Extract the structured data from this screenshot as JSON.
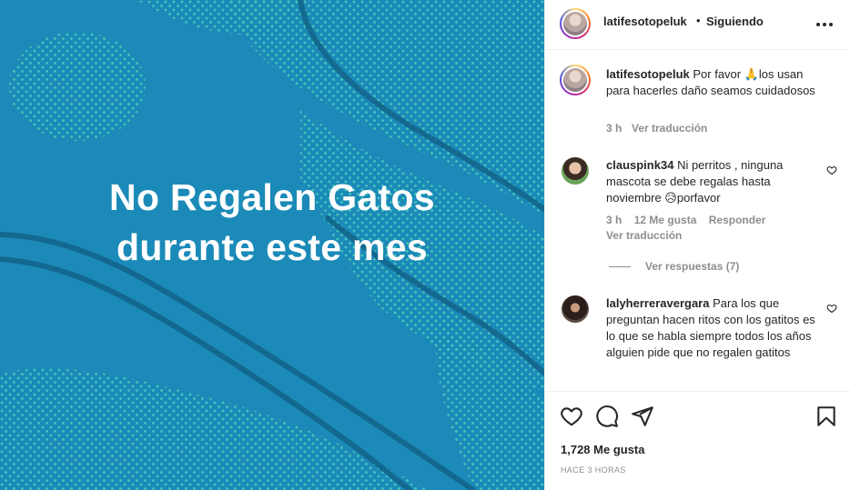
{
  "post_image": {
    "headline_line1": "No Regalen Gatos",
    "headline_line2": "durante este mes",
    "background_color": "#1b8ab8",
    "dot_color": "#4fd1b8"
  },
  "header": {
    "username": "latifesotopeluk",
    "separator": "•",
    "follow_status": "Siguiendo",
    "more_icon": "more-horizontal-icon"
  },
  "caption": {
    "username": "latifesotopeluk",
    "text": "Por favor 🙏los usan para hacerles daño seamos cuidadosos",
    "age": "3 h",
    "translate": "Ver traducción"
  },
  "comments": [
    {
      "username": "clauspink34",
      "text": "Ni perritos , ninguna mascota se debe regalas hasta noviembre 😥porfavor",
      "age": "3 h",
      "likes": "12 Me gusta",
      "reply": "Responder",
      "translate": "Ver traducción",
      "view_replies": "Ver respuestas (7)"
    },
    {
      "username": "lalyherreravergara",
      "text": "Para los que preguntan hacen ritos con los gatitos es lo que se habla siempre todos los años alguien pide que no regalen gatitos"
    }
  ],
  "actions": {
    "likes_count": "1,728 Me gusta",
    "posted_ago": "HACE 3 HORAS"
  }
}
